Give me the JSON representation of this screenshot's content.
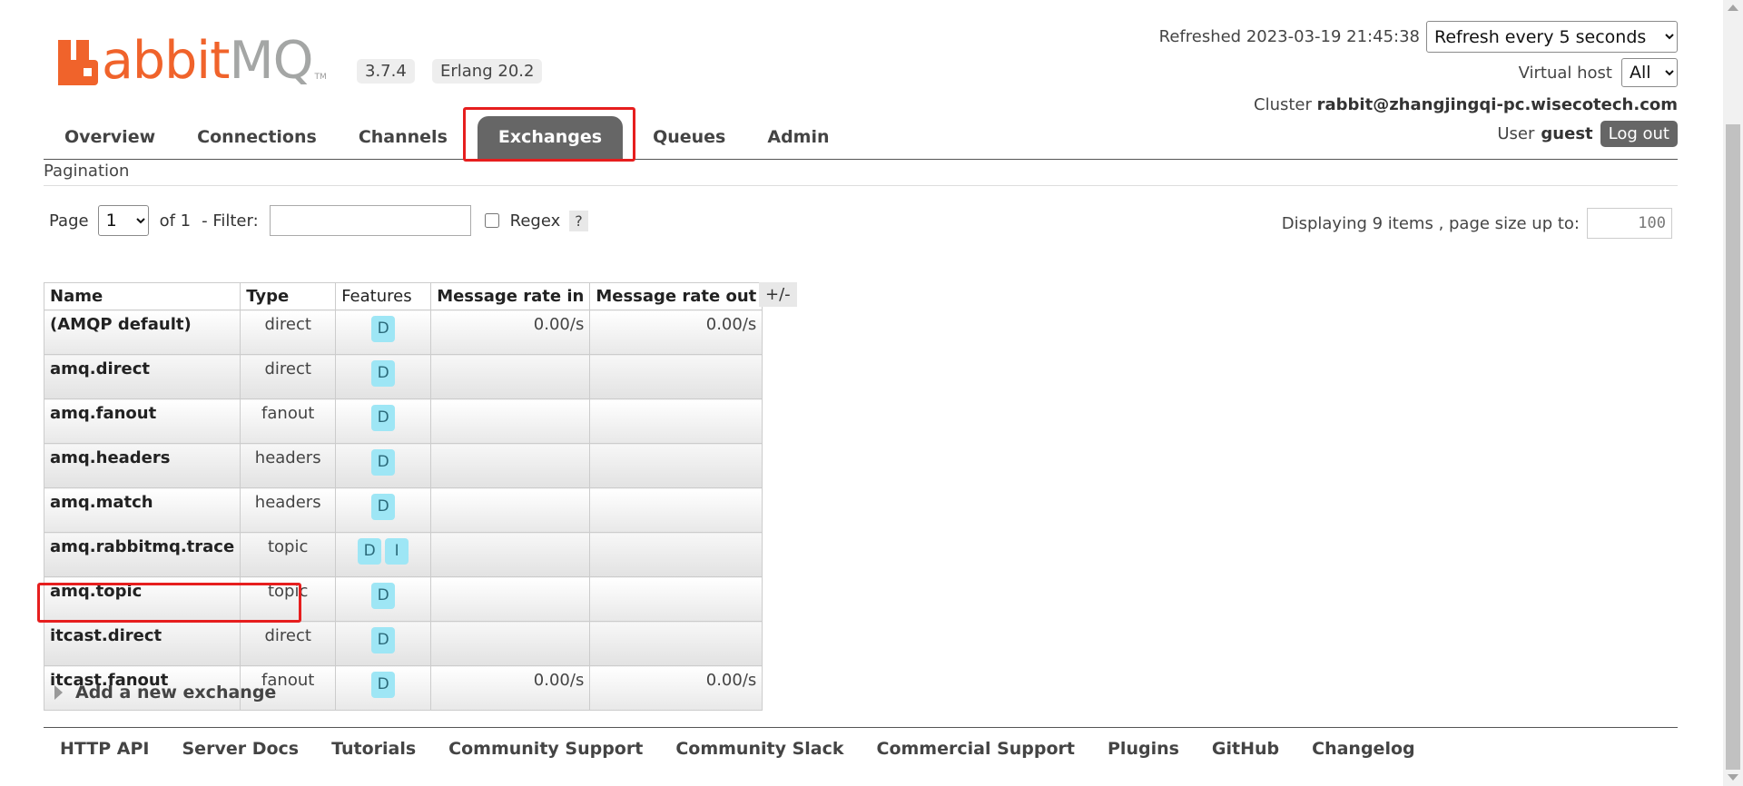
{
  "brand": {
    "logo_r": "R",
    "logo_abbit": "abbit",
    "logo_mq": "MQ",
    "logo_tm": "TM"
  },
  "header": {
    "version": "3.7.4",
    "erlang": "Erlang 20.2",
    "refreshed_label": "Refreshed 2023-03-19 21:45:38",
    "refresh_select": "Refresh every 5 seconds",
    "virtual_host_label": "Virtual host",
    "virtual_host_value": "All",
    "cluster_label": "Cluster",
    "cluster_value": "rabbit@zhangjingqi-pc.wisecotech.com",
    "user_label": "User",
    "user_value": "guest",
    "logout": "Log out"
  },
  "nav": {
    "tabs": [
      {
        "label": "Overview"
      },
      {
        "label": "Connections"
      },
      {
        "label": "Channels"
      },
      {
        "label": "Exchanges"
      },
      {
        "label": "Queues"
      },
      {
        "label": "Admin"
      }
    ],
    "active": "Exchanges"
  },
  "section_title": "Pagination",
  "pagination": {
    "page_label": "Page",
    "page_value": "1",
    "of_label": "of 1",
    "filter_label": "- Filter:",
    "filter_value": "",
    "regex_label": "Regex",
    "help": "?",
    "display_label": "Displaying 9 items , page size up to:",
    "page_size": "100"
  },
  "table": {
    "headers": {
      "name": "Name",
      "type": "Type",
      "features": "Features",
      "rate_in": "Message rate in",
      "rate_out": "Message rate out"
    },
    "toggle": "+/-",
    "rows": [
      {
        "name": "(AMQP default)",
        "type": "direct",
        "features": [
          "D"
        ],
        "rate_in": "0.00/s",
        "rate_out": "0.00/s"
      },
      {
        "name": "amq.direct",
        "type": "direct",
        "features": [
          "D"
        ],
        "rate_in": "",
        "rate_out": ""
      },
      {
        "name": "amq.fanout",
        "type": "fanout",
        "features": [
          "D"
        ],
        "rate_in": "",
        "rate_out": ""
      },
      {
        "name": "amq.headers",
        "type": "headers",
        "features": [
          "D"
        ],
        "rate_in": "",
        "rate_out": ""
      },
      {
        "name": "amq.match",
        "type": "headers",
        "features": [
          "D"
        ],
        "rate_in": "",
        "rate_out": ""
      },
      {
        "name": "amq.rabbitmq.trace",
        "type": "topic",
        "features": [
          "D",
          "I"
        ],
        "rate_in": "",
        "rate_out": ""
      },
      {
        "name": "amq.topic",
        "type": "topic",
        "features": [
          "D"
        ],
        "rate_in": "",
        "rate_out": ""
      },
      {
        "name": "itcast.direct",
        "type": "direct",
        "features": [
          "D"
        ],
        "rate_in": "",
        "rate_out": ""
      },
      {
        "name": "itcast.fanout",
        "type": "fanout",
        "features": [
          "D"
        ],
        "rate_in": "0.00/s",
        "rate_out": "0.00/s"
      }
    ]
  },
  "add_exchange": "Add a new exchange",
  "footer": {
    "links": [
      {
        "label": "HTTP API"
      },
      {
        "label": "Server Docs"
      },
      {
        "label": "Tutorials"
      },
      {
        "label": "Community Support"
      },
      {
        "label": "Community Slack"
      },
      {
        "label": "Commercial Support"
      },
      {
        "label": "Plugins"
      },
      {
        "label": "GitHub"
      },
      {
        "label": "Changelog"
      }
    ]
  },
  "colors": {
    "brand_orange": "#f0632b",
    "nav_active": "#666666",
    "highlight_red": "#e61e1e",
    "feature_badge": "#9ee6f5"
  }
}
